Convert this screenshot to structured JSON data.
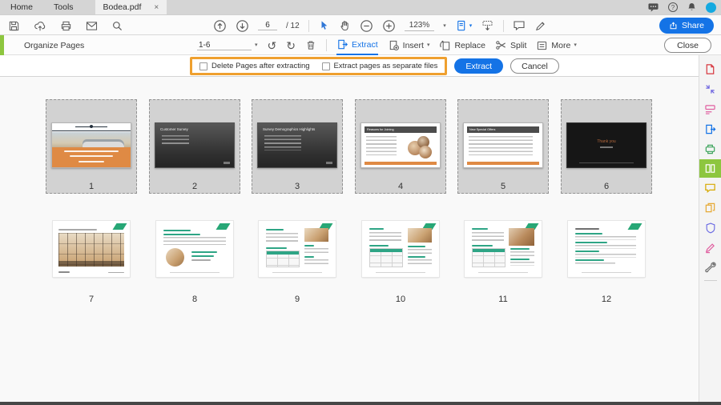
{
  "colors": {
    "accent_blue": "#1473E6",
    "accent_green": "#8DC63F",
    "callout_orange": "#EFA02F",
    "selected_thumb_bg": "#D2D2D2"
  },
  "icons": {
    "rotate_ccw": "↺",
    "rotate_cw": "↻",
    "caret_down": "▾",
    "close_tab": "×",
    "help": "?"
  },
  "tabbar": {
    "tabs": [
      {
        "label": "Home"
      },
      {
        "label": "Tools"
      }
    ],
    "document_tab": "Bodea.pdf"
  },
  "toolbar": {
    "page_current": "6",
    "page_total": "/ 12",
    "zoom_level": "123%",
    "share_label": "Share"
  },
  "organize_bar": {
    "title": "Organize Pages",
    "page_range": "1-6",
    "tools": {
      "extract": "Extract",
      "insert": "Insert",
      "replace": "Replace",
      "split": "Split",
      "more": "More"
    },
    "close_label": "Close"
  },
  "extract_bar": {
    "delete_after_label": "Delete Pages after extracting",
    "separate_files_label": "Extract pages as separate files",
    "extract_label": "Extract",
    "cancel_label": "Cancel"
  },
  "pages": [
    {
      "number": "1",
      "selected": true
    },
    {
      "number": "2",
      "selected": true,
      "title": "Customer Survey"
    },
    {
      "number": "3",
      "selected": true,
      "title": "Survey Demographics Highlights"
    },
    {
      "number": "4",
      "selected": true,
      "title": "Reasons for Joining"
    },
    {
      "number": "5",
      "selected": true,
      "title": "New Special Offers"
    },
    {
      "number": "6",
      "selected": true,
      "title": "Thank you"
    },
    {
      "number": "7",
      "selected": false
    },
    {
      "number": "8",
      "selected": false
    },
    {
      "number": "9",
      "selected": false
    },
    {
      "number": "10",
      "selected": false
    },
    {
      "number": "11",
      "selected": false
    },
    {
      "number": "12",
      "selected": false
    }
  ],
  "sidebar": {
    "active_tool": "organize-pages",
    "tools": [
      "create-pdf",
      "combine-files",
      "edit-pdf",
      "export-pdf",
      "scan-ocr",
      "organize-pages",
      "comment",
      "compress-pdf",
      "protect",
      "fill-sign",
      "more-tools"
    ]
  }
}
